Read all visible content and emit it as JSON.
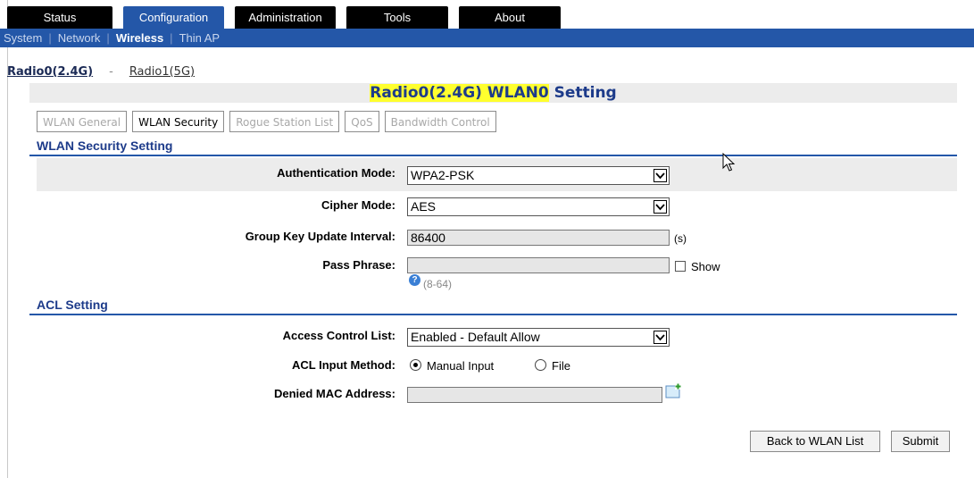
{
  "top_tabs": [
    "Status",
    "Configuration",
    "Administration",
    "Tools",
    "About"
  ],
  "active_top_tab": "Configuration",
  "sub_nav": [
    "System",
    "Network",
    "Wireless",
    "Thin AP"
  ],
  "active_sub_nav": "Wireless",
  "radio_links": {
    "radio0": "Radio0(2.4G)",
    "dash": "-",
    "radio1": "Radio1(5G)"
  },
  "page_title": {
    "highlighted": "Radio0(2.4G) WLAN0",
    "rest": "Setting"
  },
  "sub_tabs": [
    "WLAN General",
    "WLAN Security",
    "Rogue Station List",
    "QoS",
    "Bandwidth Control"
  ],
  "active_sub_tab": "WLAN Security",
  "wlan_security": {
    "section_title": "WLAN Security Setting",
    "auth_mode": {
      "label": "Authentication Mode:",
      "value": "WPA2-PSK"
    },
    "cipher_mode": {
      "label": "Cipher Mode:",
      "value": "AES"
    },
    "group_key": {
      "label": "Group Key Update Interval:",
      "value": "86400",
      "unit": "(s)"
    },
    "pass_phrase": {
      "label": "Pass Phrase:",
      "value": "",
      "show_label": "Show",
      "hint": "(8-64)"
    }
  },
  "acl": {
    "section_title": "ACL Setting",
    "access_control_list": {
      "label": "Access Control List:",
      "value": "Enabled - Default Allow"
    },
    "input_method": {
      "label": "ACL Input Method:",
      "option_manual": "Manual Input",
      "option_file": "File",
      "selected": "Manual Input"
    },
    "denied_mac": {
      "label": "Denied MAC Address:",
      "value": ""
    }
  },
  "buttons": {
    "back": "Back to WLAN List",
    "submit": "Submit"
  },
  "colors": {
    "nav_blue": "#2457a8",
    "title_blue": "#1d3b8a",
    "highlight": "#ffff2e"
  }
}
